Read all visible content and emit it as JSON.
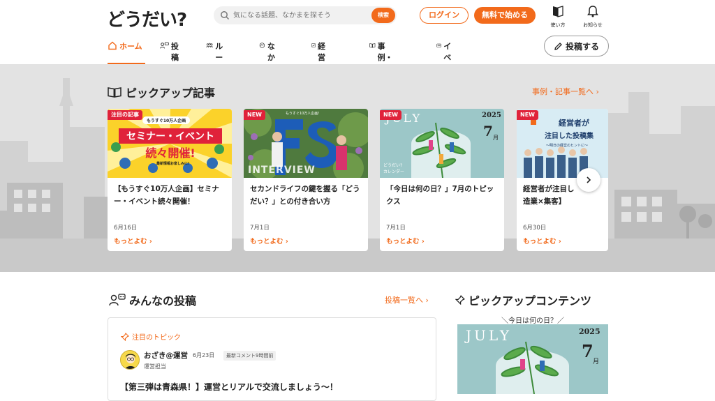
{
  "header": {
    "logo": "どうだい?",
    "search_placeholder": "気になる話題、なかまを探そう",
    "search_button": "検索",
    "login": "ログイン",
    "signup": "無料で始める",
    "guide": "使い方",
    "notice": "お知らせ"
  },
  "nav": {
    "items": [
      {
        "label": "ホーム",
        "icon": "home-icon",
        "active": true
      },
      {
        "label": "投稿",
        "icon": "people-chat-icon"
      },
      {
        "label": "ルーム",
        "icon": "group-icon"
      },
      {
        "label": "なかま",
        "icon": "handshake-icon"
      },
      {
        "label": "経営支援",
        "icon": "chart-icon"
      },
      {
        "label": "事例・記事",
        "icon": "book-icon"
      },
      {
        "label": "イベント",
        "icon": "event-icon"
      }
    ],
    "post_button": "投稿する"
  },
  "pickup": {
    "title": "ピックアップ記事",
    "more": "事例・記事一覧へ",
    "cards": [
      {
        "badge": "注目の記事",
        "title": "【もうすぐ10万人企画】セミナー・イベント続々開催！",
        "date": "6月16日",
        "more": "もっとよむ",
        "thumb_text1": "セミナー・イベント",
        "thumb_text2": "続々開催!",
        "thumb_small": "もうすぐ10万人企画",
        "thumb_note": "最新情報お楽しみに!"
      },
      {
        "badge": "NEW",
        "title": "セカンドライフの鍵を握る「どうだい？」との付き合い方",
        "date": "7月1日",
        "more": "もっとよむ",
        "thumb_text1": "INTERVIEW",
        "thumb_small": "もうすぐ10万人企画!"
      },
      {
        "badge": "NEW",
        "title": "「今日は何の日？」7月のトピックス",
        "date": "7月1日",
        "more": "もっとよむ",
        "thumb_text1": "JULY",
        "thumb_year": "2025",
        "thumb_month": "7",
        "thumb_month_unit": "月",
        "thumb_cal1": "どうだい?",
        "thumb_cal2": "カレンダー"
      },
      {
        "badge": "NEW",
        "title": "経営者が注目し",
        "title2": "造業×集客】",
        "date": "6月30日",
        "more": "もっとよむ",
        "thumb_text1": "経営者が",
        "thumb_text2": "注目した投稿集",
        "thumb_note": "〜明日の経営のヒントに〜"
      }
    ]
  },
  "posts": {
    "title": "みんなの投稿",
    "more": "投稿一覧へ",
    "topic_label": "注目のトピック",
    "poster_name": "おざき@運営",
    "poster_date": "6月23日",
    "poster_comment": "最新コメント9時間前",
    "poster_role": "運営担当",
    "post_title": "【第三弾は青森県！】運営とリアルで交流しましょう〜！"
  },
  "side": {
    "title": "ピックアップコンテンツ",
    "subtitle": "＼今日は何の日？／",
    "img_text": "JULY",
    "img_year": "2025",
    "img_month": "7",
    "img_month_unit": "月"
  },
  "colors": {
    "accent": "#f26a1b",
    "badge": "#e0223a"
  }
}
